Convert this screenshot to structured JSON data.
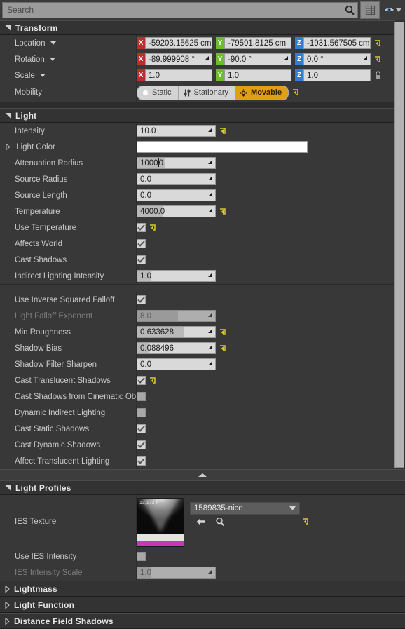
{
  "toolbar": {
    "search_placeholder": "Search",
    "search_value": "",
    "search_icon": "magnifier-icon",
    "grid_button_icon": "grid-view-icon",
    "visibility_icon": "eye-icon",
    "visibility_dropdown_icon": "chevron-down-icon"
  },
  "sections": {
    "transform": "Transform",
    "light": "Light",
    "light_profiles": "Light Profiles",
    "lightmass": "Lightmass",
    "light_function": "Light Function",
    "distance_field_shadows": "Distance Field Shadows"
  },
  "transform": {
    "location": {
      "label": "Location",
      "x": "-59203.15625 cm",
      "y": "-79591.8125 cm",
      "z": "-1931.567505 cm"
    },
    "rotation": {
      "label": "Rotation",
      "x": "-89.999908 °",
      "y": "-90.0 °",
      "z": "0.0 °"
    },
    "scale": {
      "label": "Scale",
      "x": "1.0",
      "y": "1.0",
      "z": "1.0",
      "lock_icon": "unlocked-padlock-icon"
    },
    "axis_keys": {
      "x": "X",
      "y": "Y",
      "z": "Z"
    },
    "axis_colors": {
      "x": "#bb2e2e",
      "y": "#6fbb2e",
      "z": "#2e7fd8"
    },
    "mobility": {
      "label": "Mobility",
      "options": [
        "Static",
        "Stationary",
        "Movable"
      ],
      "selected": "Movable",
      "selected_color": "#e0a013",
      "icons": [
        "dot-icon",
        "sliders-icon",
        "move-arrows-icon"
      ]
    }
  },
  "light": {
    "intensity": {
      "label": "Intensity",
      "value": "10.0",
      "reverted": true
    },
    "light_color": {
      "label": "Light Color",
      "value": "#ffffff"
    },
    "attenuation_radius": {
      "label": "Attenuation Radius",
      "value_pre": "1000",
      "value_post": "0",
      "editing": true,
      "fill_pct": 36
    },
    "source_radius": {
      "label": "Source Radius",
      "value": "0.0"
    },
    "source_length": {
      "label": "Source Length",
      "value": "0.0"
    },
    "temperature": {
      "label": "Temperature",
      "value": "4000.0",
      "reverted": true,
      "fill_pct": 33
    },
    "use_temperature": {
      "label": "Use Temperature",
      "checked": true,
      "reverted": true
    },
    "affects_world": {
      "label": "Affects World",
      "checked": true
    },
    "cast_shadows": {
      "label": "Cast Shadows",
      "checked": true
    },
    "indirect_lighting_intensity": {
      "label": "Indirect Lighting Intensity",
      "value": "1.0",
      "fill_pct": 17
    },
    "use_inverse_squared_falloff": {
      "label": "Use Inverse Squared Falloff",
      "checked": true
    },
    "light_falloff_exponent": {
      "label": "Light Falloff Exponent",
      "value": "8.0",
      "disabled": true,
      "fill_pct": 52
    },
    "min_roughness": {
      "label": "Min Roughness",
      "value": "0.633628",
      "reverted": true,
      "fill_pct": 60
    },
    "shadow_bias": {
      "label": "Shadow Bias",
      "value": "0.088496",
      "reverted": true,
      "fill_pct": 15
    },
    "shadow_filter_sharpen": {
      "label": "Shadow Filter Sharpen",
      "value": "0.0"
    },
    "cast_translucent_shadows": {
      "label": "Cast Translucent Shadows",
      "checked": true,
      "reverted": true
    },
    "cast_shadows_from_cinematic_objects": {
      "label": "Cast Shadows from Cinematic Obje",
      "checked": false
    },
    "dynamic_indirect_lighting": {
      "label": "Dynamic Indirect Lighting",
      "checked": false
    },
    "cast_static_shadows": {
      "label": "Cast Static Shadows",
      "checked": true
    },
    "cast_dynamic_shadows": {
      "label": "Cast Dynamic Shadows",
      "checked": true
    },
    "affect_translucent_lighting": {
      "label": "Affect Translucent Lighting",
      "checked": true
    },
    "collapse_advanced_icon": "collapse-advanced-icon"
  },
  "light_profiles": {
    "ies_texture": {
      "label": "IES Texture",
      "asset_name": "1589835-nice",
      "thumbnail_label": "13,172 ft",
      "dropdown_icon": "chevron-down-icon",
      "back_icon": "use-selected-asset-icon",
      "browse_icon": "browse-asset-icon",
      "reverted": true
    },
    "use_ies_intensity": {
      "label": "Use IES Intensity",
      "checked": false
    },
    "ies_intensity_scale": {
      "label": "IES Intensity Scale",
      "value": "1.0",
      "disabled": true,
      "fill_pct": 17
    }
  }
}
